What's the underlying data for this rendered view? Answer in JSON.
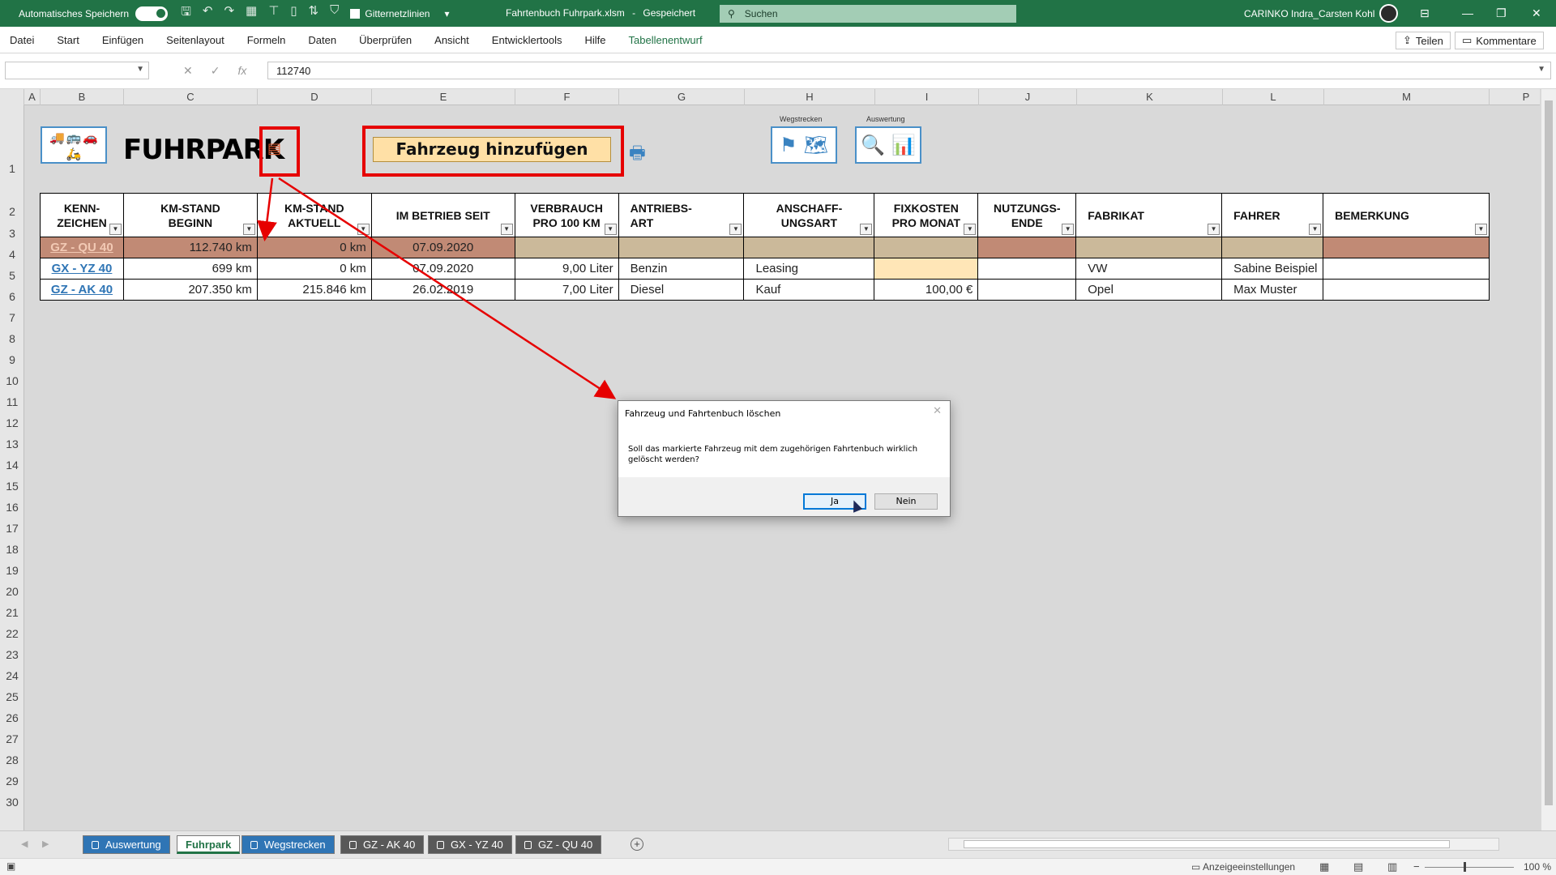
{
  "titlebar": {
    "autosave_label": "Automatisches Speichern",
    "gridlines_label": "Gitternetzlinien",
    "file_name": "Fahrtenbuch Fuhrpark.xlsm",
    "save_state": "Gespeichert",
    "search_placeholder": "Suchen",
    "user": "CARINKO Indra_Carsten Kohl",
    "accent_color": "#217346"
  },
  "menu": {
    "items": [
      "Datei",
      "Start",
      "Einfügen",
      "Seitenlayout",
      "Formeln",
      "Daten",
      "Überprüfen",
      "Ansicht",
      "Entwicklertools",
      "Hilfe",
      "Tabellenentwurf"
    ],
    "share": "Teilen",
    "comments": "Kommentare"
  },
  "formula": {
    "name_box": "",
    "value": "112740"
  },
  "columns": [
    "A",
    "B",
    "C",
    "D",
    "E",
    "F",
    "G",
    "H",
    "I",
    "J",
    "K",
    "L",
    "M",
    "P"
  ],
  "rows": [
    "1",
    "2",
    "3",
    "4",
    "5",
    "6",
    "7",
    "8",
    "9",
    "10",
    "11",
    "12",
    "13",
    "14",
    "15",
    "16",
    "17",
    "18",
    "19",
    "20",
    "21",
    "22",
    "23",
    "24",
    "25",
    "26",
    "27",
    "28",
    "29",
    "30"
  ],
  "sheet": {
    "brand": "FUHRPARK",
    "add_vehicle": "Fahrzeug hinzufügen",
    "btn_routes_label": "Wegstrecken",
    "btn_eval_label": "Auswertung"
  },
  "table": {
    "headers": [
      [
        "KENN-",
        "ZEICHEN"
      ],
      [
        "KM-STAND",
        "BEGINN"
      ],
      [
        "KM-STAND",
        "AKTUELL"
      ],
      [
        "IM BETRIEB SEIT",
        ""
      ],
      [
        "VERBRAUCH",
        "PRO 100 KM"
      ],
      [
        "ANTRIEBS-",
        "ART"
      ],
      [
        "ANSCHAFF-",
        "UNGSART"
      ],
      [
        "FIXKOSTEN",
        "PRO MONAT"
      ],
      [
        "NUTZUNGS-",
        "ENDE"
      ],
      [
        "FABRIKAT",
        ""
      ],
      [
        "FAHRER",
        ""
      ],
      [
        "BEMERKUNG",
        ""
      ]
    ],
    "rows": [
      [
        "GZ - QU 40",
        "112.740 km",
        "0 km",
        "07.09.2020",
        "",
        "",
        "",
        "",
        "",
        "",
        "",
        ""
      ],
      [
        "GX - YZ 40",
        "699 km",
        "0 km",
        "07.09.2020",
        "9,00 Liter",
        "Benzin",
        "Leasing",
        "",
        "",
        "VW",
        "Sabine Beispiel",
        ""
      ],
      [
        "GZ - AK 40",
        "207.350 km",
        "215.846 km",
        "26.02.2019",
        "7,00 Liter",
        "Diesel",
        "Kauf",
        "100,00 €",
        "",
        "Opel",
        "Max Muster",
        ""
      ]
    ],
    "selected_row_color": "#cbb99a",
    "highlight_color": "#c18a75"
  },
  "dialog": {
    "title": "Fahrzeug und Fahrtenbuch löschen",
    "message_line1": "Soll das markierte Fahrzeug mit dem zugehörigen Fahrtenbuch wirklich",
    "message_line2": "gelöscht werden?",
    "yes": "Ja",
    "no": "Nein"
  },
  "tabs": [
    {
      "label": "Auswertung",
      "style": "blue"
    },
    {
      "label": "Fuhrpark",
      "style": "active"
    },
    {
      "label": "Wegstrecken",
      "style": "blue"
    },
    {
      "label": "GZ - AK 40",
      "style": "gray"
    },
    {
      "label": "GX - YZ 40",
      "style": "gray"
    },
    {
      "label": "GZ - QU 40",
      "style": "gray"
    }
  ],
  "status": {
    "display_settings": "Anzeigeeinstellungen",
    "zoom": "100 %"
  },
  "annotation_color": "#e60000"
}
